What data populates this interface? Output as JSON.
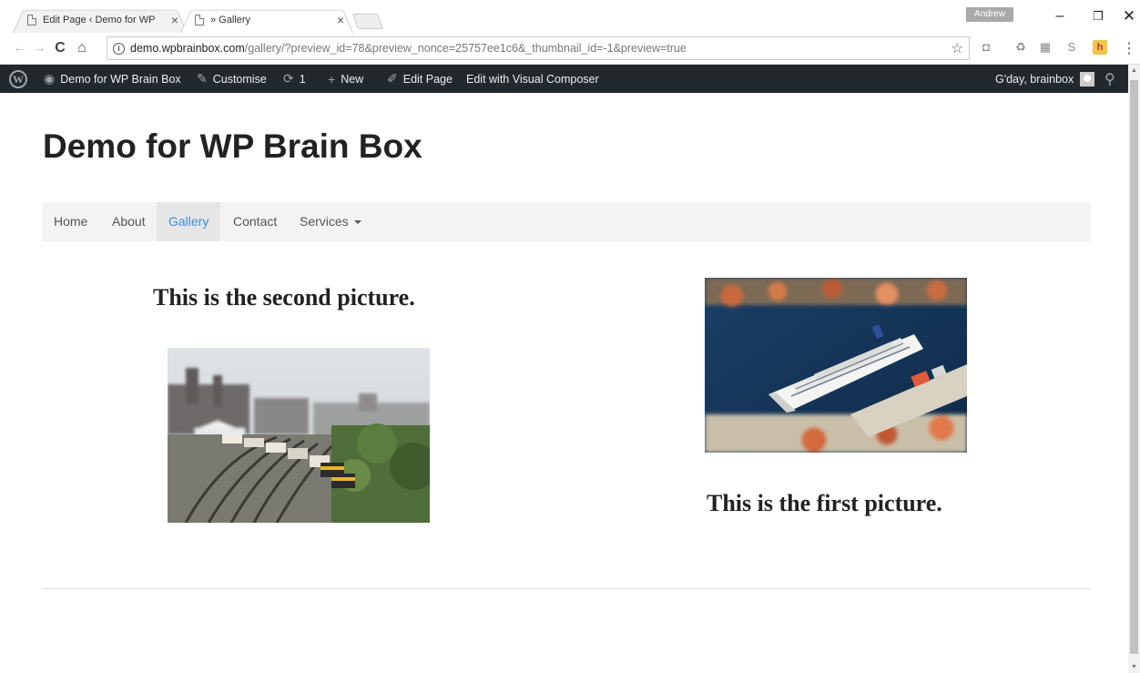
{
  "browser": {
    "tabs": [
      {
        "title": "Edit Page ‹ Demo for WP",
        "close": "×"
      },
      {
        "title": "» Gallery",
        "close": "×"
      }
    ],
    "profile_name": "Andrew",
    "window": {
      "minimize": "–",
      "maximize": "❐",
      "close": "✕"
    },
    "nav": {
      "back": "←",
      "forward": "→",
      "reload": "C",
      "home": "⌂"
    },
    "url_host": "demo.wpbrainbox.com",
    "url_path": "/gallery/?preview_id=78&preview_nonce=25757ee1c6&_thumbnail_id=-1&preview=true",
    "info_glyph": "i",
    "star_glyph": "☆",
    "menu_glyph": "⋮",
    "extensions": [
      "camera-icon",
      "refresh-ext-icon",
      "printer-icon",
      "skype-icon",
      "honey-icon"
    ],
    "extension_glyphs": [
      "◘",
      "♻",
      "▦",
      "S",
      "h"
    ]
  },
  "adminbar": {
    "wp_logo": "W",
    "site_name": "Demo for WP Brain Box",
    "customise": "Customise",
    "updates_count": "1",
    "new": "New",
    "edit_page": "Edit Page",
    "visual_composer": "Edit with Visual Composer",
    "howdy": "G'day, brainbox",
    "glyphs": {
      "site": "◉",
      "customise": "✎",
      "updates": "⟳",
      "new": "+",
      "edit": "✐",
      "search": "⚲"
    }
  },
  "page": {
    "site_title": "Demo for WP Brain Box",
    "menu": [
      {
        "label": "Home"
      },
      {
        "label": "About"
      },
      {
        "label": "Gallery",
        "active": true
      },
      {
        "label": "Contact"
      },
      {
        "label": "Services"
      }
    ],
    "captions": {
      "second": "This is the second picture.",
      "first": "This is the first picture."
    }
  },
  "scrollbar": {
    "up": "▲",
    "down": "▼"
  },
  "colors": {
    "adminbar_bg": "#23282d",
    "nav_active": "#3a8ee6",
    "navbar_bg": "#f3f3f3"
  }
}
